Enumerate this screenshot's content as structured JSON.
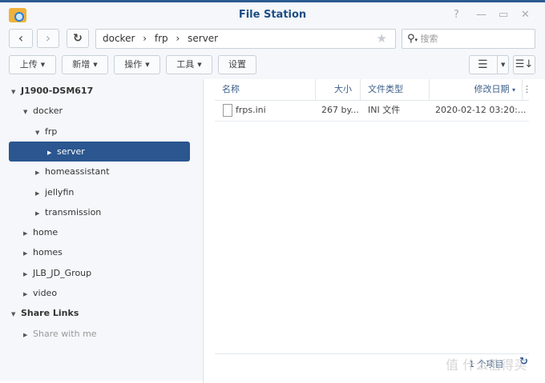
{
  "window": {
    "title": "File Station",
    "help": "?",
    "minimize": "—",
    "maximize": "▭",
    "close": "✕"
  },
  "nav": {
    "back": "‹",
    "forward": "›",
    "refresh": "↻"
  },
  "path": {
    "segments": [
      "docker",
      "frp",
      "server"
    ],
    "separator": "›",
    "favorite": "★"
  },
  "search": {
    "placeholder": "搜索"
  },
  "toolbar": {
    "upload": "上传",
    "create": "新增",
    "action": "操作",
    "tools": "工具",
    "settings": "设置"
  },
  "tree": [
    {
      "label": "J1900-DSM617",
      "level": 0,
      "type": "header",
      "expanded": true
    },
    {
      "label": "docker",
      "level": 1,
      "expanded": true
    },
    {
      "label": "frp",
      "level": 2,
      "expanded": true
    },
    {
      "label": "server",
      "level": 3,
      "selected": true
    },
    {
      "label": "homeassistant",
      "level": 2
    },
    {
      "label": "jellyfin",
      "level": 2
    },
    {
      "label": "transmission",
      "level": 2
    },
    {
      "label": "home",
      "level": 1
    },
    {
      "label": "homes",
      "level": 1
    },
    {
      "label": "JLB_JD_Group",
      "level": 1
    },
    {
      "label": "video",
      "level": 1
    },
    {
      "label": "Share Links",
      "level": 0,
      "type": "header",
      "expanded": true
    },
    {
      "label": "Share with me",
      "level": 1,
      "dim": true
    }
  ],
  "table": {
    "columns": [
      "名称",
      "大小",
      "文件类型",
      "修改日期"
    ],
    "sort_indicator": "▾",
    "rows": [
      {
        "name": "frps.ini",
        "size": "267 by...",
        "type": "INI 文件",
        "modified": "2020-02-12 03:20:..."
      }
    ]
  },
  "footer": {
    "count": "1 个项目"
  },
  "colors": {
    "accent": "#2b568f",
    "title": "#1f4e85"
  },
  "watermark": "值 什么值得买"
}
